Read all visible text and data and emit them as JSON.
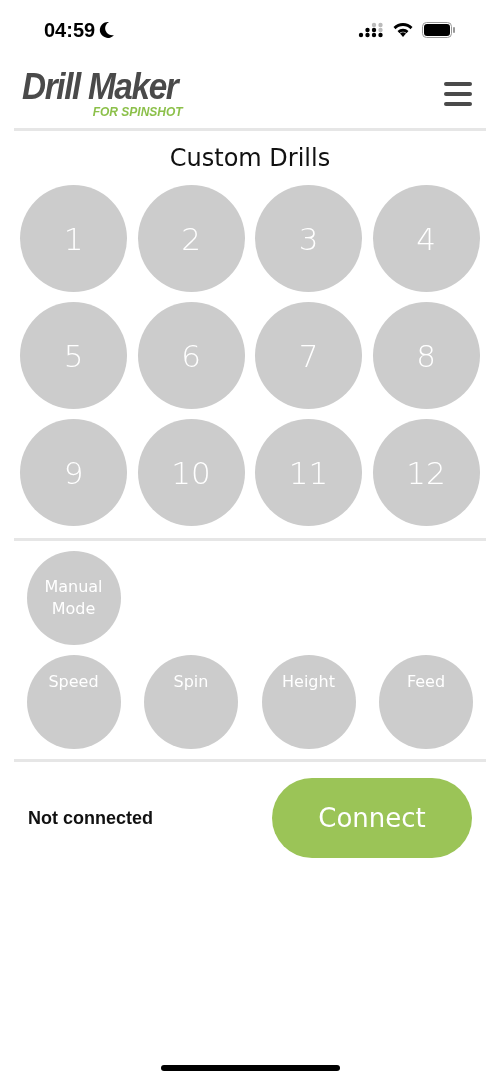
{
  "status_bar": {
    "time": "04:59",
    "focus_moon": true
  },
  "header": {
    "logo_title": "Drill Maker",
    "logo_subtitle": "FOR SPINSHOT"
  },
  "title": "Custom Drills",
  "drills": [
    "1",
    "2",
    "3",
    "4",
    "5",
    "6",
    "7",
    "8",
    "9",
    "10",
    "11",
    "12"
  ],
  "manual_mode": {
    "label": "Manual Mode"
  },
  "controls": [
    "Speed",
    "Spin",
    "Height",
    "Feed"
  ],
  "connection": {
    "status": "Not connected",
    "button": "Connect",
    "connected": false
  }
}
